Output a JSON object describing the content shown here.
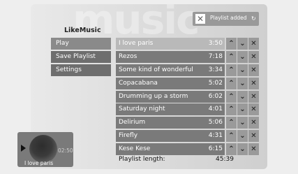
{
  "app": {
    "watermark": "music",
    "title": "LikeMusic"
  },
  "menu": {
    "items": [
      {
        "label": "Play"
      },
      {
        "label": "Save Playlist"
      },
      {
        "label": "Settings"
      }
    ]
  },
  "toast": {
    "close_glyph": "✕",
    "text": "Playlist added",
    "spinner_icon": "spinner-icon"
  },
  "playlist": {
    "tracks": [
      {
        "title": "I love paris",
        "duration": "3:50"
      },
      {
        "title": "Rezos",
        "duration": "7:18"
      },
      {
        "title": "Some kind of wonderful",
        "duration": "3:34"
      },
      {
        "title": "Copacabana",
        "duration": "5:02"
      },
      {
        "title": "Drumming up a storm",
        "duration": "6:02"
      },
      {
        "title": "Saturday night",
        "duration": "4:01"
      },
      {
        "title": "Delirium",
        "duration": "5:06"
      },
      {
        "title": "Firefly",
        "duration": "4:31"
      },
      {
        "title": "Kese Kese",
        "duration": "6:15"
      }
    ],
    "selected_index": 0,
    "length_label": "Playlist length:",
    "length_value": "45:39"
  },
  "icons": {
    "up": "⌃",
    "down": "⌄",
    "delete": "✕"
  },
  "now_playing": {
    "time": "02:50",
    "title": "I love paris"
  },
  "colors": {
    "row": "#7a7a7a",
    "selected_row": "#b9b9b9",
    "button": "#9a9a9a",
    "menu": "#6e6e6e"
  }
}
